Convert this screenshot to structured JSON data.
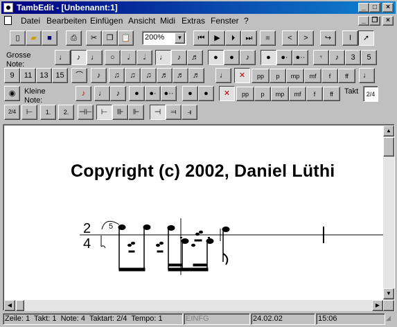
{
  "window": {
    "title": "TambEdit - [Unbenannt:1]",
    "controls": {
      "minimize": "_",
      "maximize": "□",
      "close": "×"
    },
    "doc_controls": {
      "minimize": "_",
      "restore": "❐",
      "close": "×"
    }
  },
  "menu": [
    "Datei",
    "Bearbeiten",
    "Einfügen",
    "Ansicht",
    "Midi",
    "Extras",
    "Fenster",
    "?"
  ],
  "toolbar": {
    "zoom": "200%",
    "grosse_note_label": "Grosse Note:",
    "kleine_note_label": "Kleine Note:",
    "takt_label": "Takt",
    "takt_value": "2/4",
    "dynamics_big": [
      "pp",
      "p",
      "mp",
      "mf",
      "f",
      "ff"
    ],
    "dynamics_small": [
      "pp",
      "p",
      "mp",
      "mf",
      "f",
      "ff"
    ],
    "triplet_labels": [
      "3",
      "5"
    ],
    "tuplets": [
      "9",
      "11",
      "13",
      "15"
    ],
    "repeat_labels": [
      "1.",
      "2."
    ]
  },
  "document": {
    "copyright": "Copyright (c) 2002, Daniel Lüthi",
    "time_signature": {
      "numerator": "2",
      "denominator": "4"
    },
    "tuplet_mark": "5"
  },
  "status": {
    "zeile_label": "Zeile:",
    "zeile": "1",
    "takt_label": "Takt:",
    "takt": "1",
    "note_label": "Note:",
    "note": "4",
    "taktart_label": "Taktart:",
    "taktart": "2/4",
    "tempo_label": "Tempo:",
    "tempo": "1",
    "mode": "EINFG",
    "date": "24.02.02",
    "time": "15:06"
  }
}
